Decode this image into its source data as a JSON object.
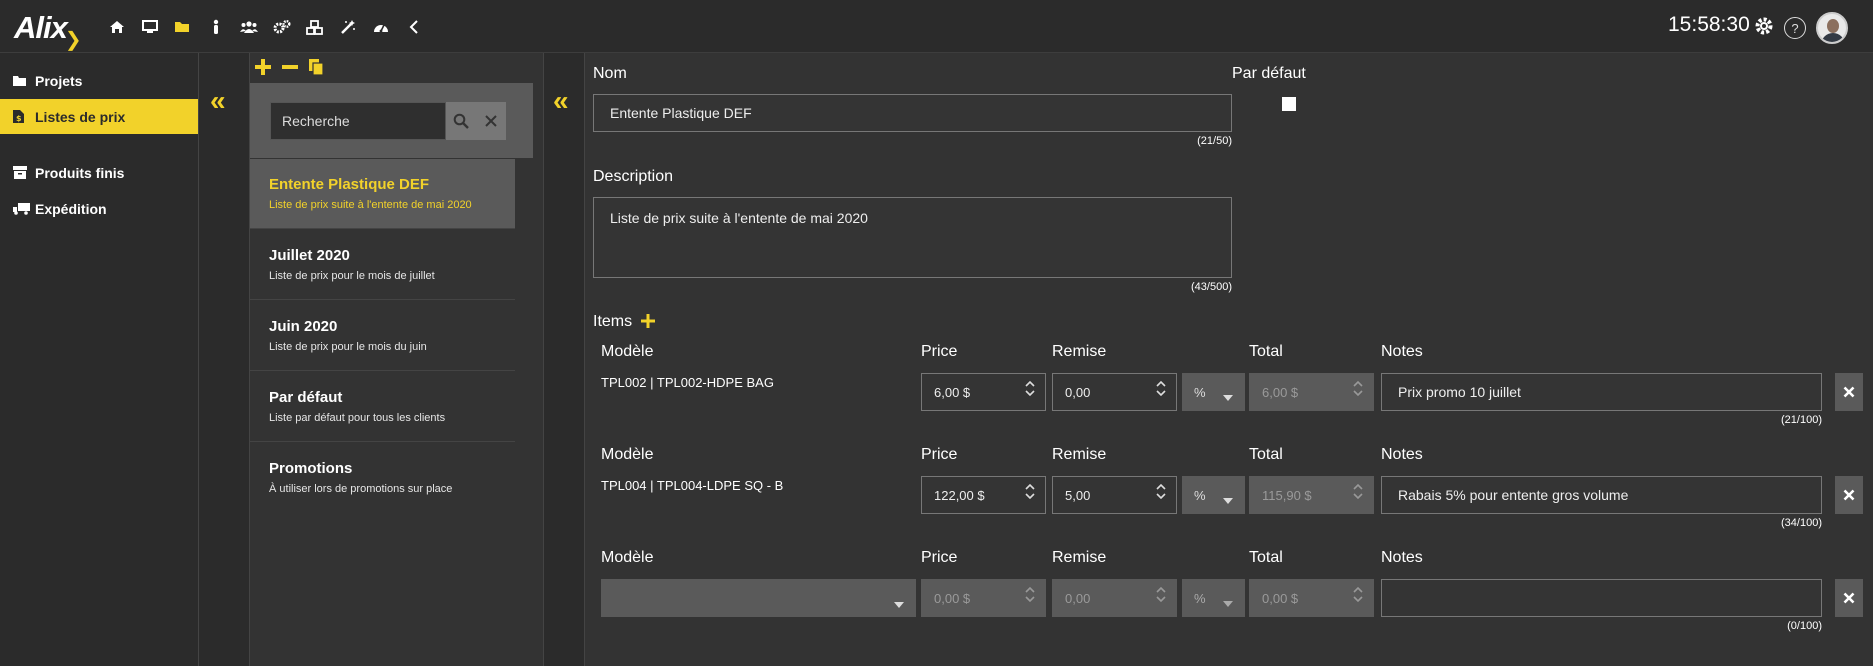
{
  "app": {
    "logo": "Alix",
    "time": "15:58:30"
  },
  "nav": {
    "icons": [
      "home-icon",
      "monitor-icon",
      "folder-icon",
      "person-icon",
      "users-icon",
      "cogs-icon",
      "cubes-icon",
      "wand-icon",
      "gauge-icon",
      "chevron-left-icon"
    ],
    "active": "folder-icon"
  },
  "sidebar": {
    "items": [
      {
        "label": "Projets",
        "icon": "folder-icon"
      },
      {
        "label": "Listes de prix",
        "icon": "price-list-icon",
        "active": true
      },
      {
        "label": "Produits finis",
        "icon": "box-icon"
      },
      {
        "label": "Expédition",
        "icon": "truck-icon"
      }
    ]
  },
  "list": {
    "search_placeholder": "Recherche",
    "items": [
      {
        "title": "Entente Plastique DEF",
        "subtitle": "Liste de prix suite à l'entente de mai 2020",
        "active": true
      },
      {
        "title": "Juillet 2020",
        "subtitle": "Liste de prix pour le mois de juillet"
      },
      {
        "title": "Juin 2020",
        "subtitle": "Liste de prix pour le mois du juin"
      },
      {
        "title": "Par défaut",
        "subtitle": "Liste par défaut pour tous les clients"
      },
      {
        "title": "Promotions",
        "subtitle": "À utiliser lors de promotions sur place"
      }
    ]
  },
  "form": {
    "name_label": "Nom",
    "name_value": "Entente Plastique DEF",
    "name_count": "(21/50)",
    "default_label": "Par défaut",
    "description_label": "Description",
    "description_value": "Liste de prix suite à l'entente de mai 2020",
    "description_count": "(43/500)",
    "items_label": "Items",
    "col_model": "Modèle",
    "col_price": "Price",
    "col_discount": "Remise",
    "col_total": "Total",
    "col_notes": "Notes",
    "rows": [
      {
        "model": "TPL002 | TPL002-HDPE BAG",
        "price": "6,00 $",
        "discount": "0,00",
        "unit": "%",
        "total": "6,00 $",
        "notes": "Prix promo 10 juillet",
        "count": "(21/100)"
      },
      {
        "model": "TPL004 | TPL004-LDPE SQ - B",
        "price": "122,00 $",
        "discount": "5,00",
        "unit": "%",
        "total": "115,90 $",
        "notes": "Rabais 5% pour entente gros volume",
        "count": "(34/100)"
      },
      {
        "model": "",
        "price": "0,00 $",
        "discount": "0,00",
        "unit": "%",
        "total": "0,00 $",
        "notes": "",
        "count": "(0/100)"
      }
    ]
  }
}
